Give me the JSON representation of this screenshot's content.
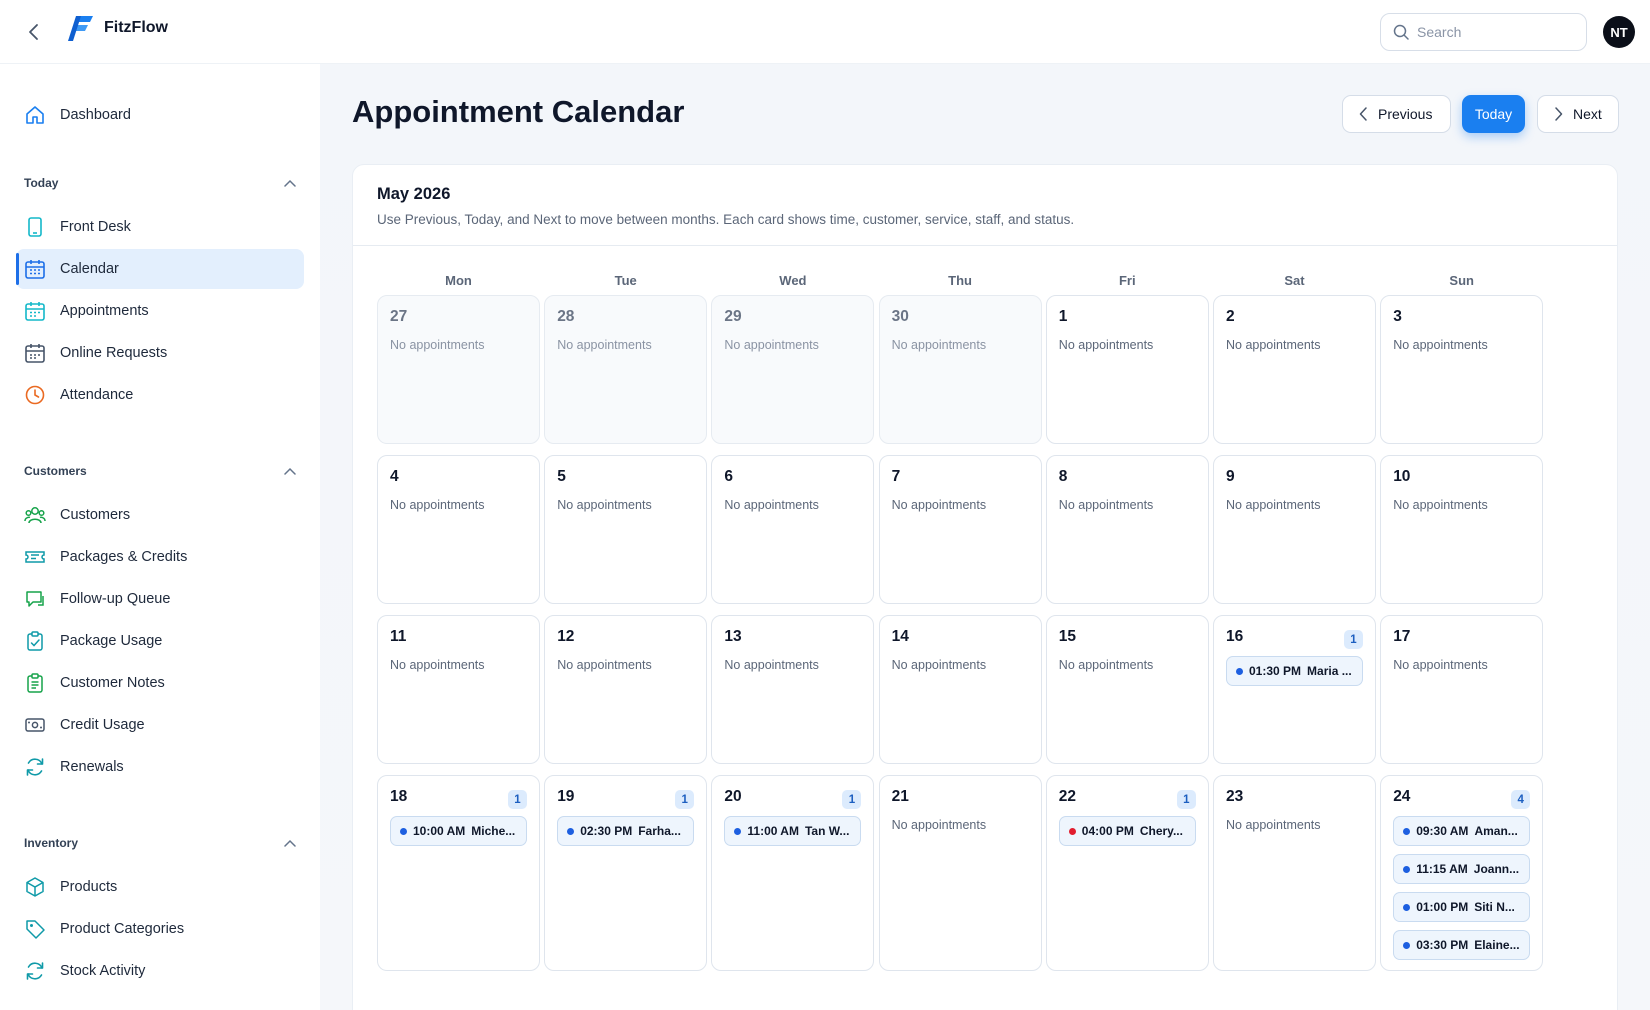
{
  "app": {
    "name": "FitzFlow",
    "user_initials": "NT"
  },
  "search": {
    "placeholder": "Search"
  },
  "sidebar": {
    "top": {
      "label": "Dashboard"
    },
    "sections": [
      {
        "title": "Today",
        "items": [
          "Front Desk",
          "Calendar",
          "Appointments",
          "Online Requests",
          "Attendance"
        ]
      },
      {
        "title": "Customers",
        "items": [
          "Customers",
          "Packages & Credits",
          "Follow-up Queue",
          "Package Usage",
          "Customer Notes",
          "Credit Usage",
          "Renewals"
        ]
      },
      {
        "title": "Inventory",
        "items": [
          "Products",
          "Product Categories",
          "Stock Activity"
        ]
      }
    ],
    "active": "Calendar"
  },
  "page": {
    "title": "Appointment Calendar",
    "prev_label": "Previous",
    "today_label": "Today",
    "next_label": "Next"
  },
  "calendar": {
    "month": "May 2026",
    "hint": "Use Previous, Today, and Next to move between months. Each card shows time, customer, service, staff, and status.",
    "empty_text": "No appointments",
    "weekdays": [
      "Mon",
      "Tue",
      "Wed",
      "Thu",
      "Fri",
      "Sat",
      "Sun"
    ],
    "weeks": [
      [
        {
          "day": "27",
          "muted": true
        },
        {
          "day": "28",
          "muted": true
        },
        {
          "day": "29",
          "muted": true
        },
        {
          "day": "30",
          "muted": true
        },
        {
          "day": "1"
        },
        {
          "day": "2"
        },
        {
          "day": "3"
        }
      ],
      [
        {
          "day": "4"
        },
        {
          "day": "5"
        },
        {
          "day": "6"
        },
        {
          "day": "7"
        },
        {
          "day": "8"
        },
        {
          "day": "9"
        },
        {
          "day": "10"
        }
      ],
      [
        {
          "day": "11"
        },
        {
          "day": "12"
        },
        {
          "day": "13"
        },
        {
          "day": "14"
        },
        {
          "day": "15"
        },
        {
          "day": "16",
          "count": "1",
          "appointments": [
            {
              "time": "01:30 PM",
              "name": "Maria ...",
              "status_color": "#1d5fe0"
            }
          ]
        },
        {
          "day": "17"
        }
      ],
      [
        {
          "day": "18",
          "count": "1",
          "appointments": [
            {
              "time": "10:00 AM",
              "name": "Miche...",
              "status_color": "#1d5fe0"
            }
          ]
        },
        {
          "day": "19",
          "count": "1",
          "appointments": [
            {
              "time": "02:30 PM",
              "name": "Farha...",
              "status_color": "#1d5fe0"
            }
          ]
        },
        {
          "day": "20",
          "count": "1",
          "appointments": [
            {
              "time": "11:00 AM",
              "name": "Tan W...",
              "status_color": "#1d5fe0"
            }
          ]
        },
        {
          "day": "21"
        },
        {
          "day": "22",
          "count": "1",
          "appointments": [
            {
              "time": "04:00 PM",
              "name": "Chery...",
              "status_color": "#e11d2e"
            }
          ]
        },
        {
          "day": "23"
        },
        {
          "day": "24",
          "count": "4",
          "appointments": [
            {
              "time": "09:30 AM",
              "name": "Aman...",
              "status_color": "#1d5fe0"
            },
            {
              "time": "11:15 AM",
              "name": "Joann...",
              "status_color": "#1d5fe0"
            },
            {
              "time": "01:00 PM",
              "name": "Siti N...",
              "status_color": "#1d5fe0"
            },
            {
              "time": "03:30 PM",
              "name": "Elaine...",
              "status_color": "#1d5fe0"
            }
          ]
        }
      ]
    ]
  },
  "colors": {
    "accent": "#1a7ff0",
    "active_bg": "#e3effd"
  }
}
